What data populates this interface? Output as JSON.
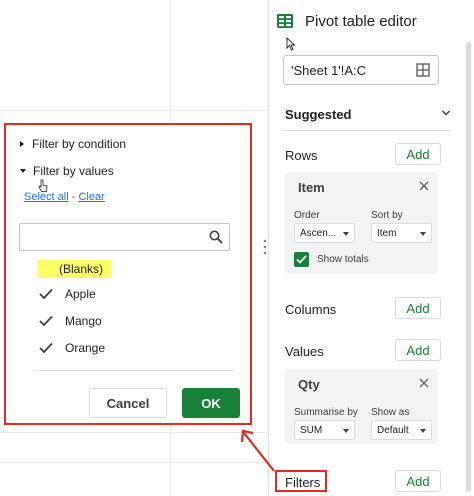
{
  "panel": {
    "title": "Pivot table editor",
    "range": "'Sheet 1'!A:C",
    "suggested": "Suggested",
    "rows_label": "Rows",
    "columns_label": "Columns",
    "values_label": "Values",
    "filters_label": "Filters",
    "add": "Add",
    "row_card": {
      "title": "Item",
      "order_label": "Order",
      "order_value": "Ascen...",
      "sortby_label": "Sort by",
      "sortby_value": "Item",
      "show_totals": "Show totals",
      "show_totals_checked": true
    },
    "value_card": {
      "title": "Qty",
      "summarise_label": "Summarise by",
      "summarise_value": "SUM",
      "showas_label": "Show as",
      "showas_value": "Default"
    }
  },
  "dialog": {
    "filter_by_condition": "Filter by condition",
    "filter_by_values": "Filter by values",
    "select_all": "Select all",
    "separator": "-",
    "clear": "Clear",
    "search_value": "",
    "values": [
      {
        "label": "(Blanks)",
        "checked": false,
        "highlighted": true
      },
      {
        "label": "Apple",
        "checked": true,
        "highlighted": false
      },
      {
        "label": "Mango",
        "checked": true,
        "highlighted": false
      },
      {
        "label": "Orange",
        "checked": true,
        "highlighted": false
      }
    ],
    "cancel": "Cancel",
    "ok": "OK"
  },
  "colors": {
    "green": "#188038",
    "red_highlight": "#d93025",
    "link_blue": "#1a73e8",
    "yellow_highlight": "#ffff66"
  }
}
